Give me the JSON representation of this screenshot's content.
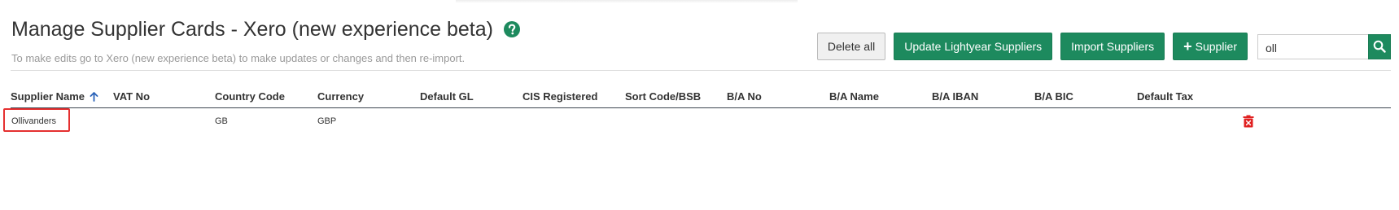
{
  "page": {
    "title": "Manage Supplier Cards - Xero (new experience beta)",
    "subtitle": "To make edits go to Xero (new experience beta) to make updates or changes and then re-import."
  },
  "toolbar": {
    "delete_all": "Delete all",
    "update_suppliers": "Update Lightyear Suppliers",
    "import_suppliers": "Import Suppliers",
    "add_supplier_plus": "+",
    "add_supplier": "Supplier",
    "search_value": "oll"
  },
  "table": {
    "columns": [
      "Supplier Name",
      "VAT No",
      "Country Code",
      "Currency",
      "Default GL",
      "CIS Registered",
      "Sort Code/BSB",
      "B/A No",
      "B/A Name",
      "B/A IBAN",
      "B/A BIC",
      "Default Tax"
    ],
    "sorted_column": "Supplier Name",
    "sort_direction": "ascending",
    "rows": [
      {
        "supplier_name": "Ollivanders",
        "vat_no": "",
        "country_code": "GB",
        "currency": "GBP",
        "default_gl": "",
        "cis_registered": "",
        "sort_code": "",
        "ba_no": "",
        "ba_name": "",
        "ba_iban": "",
        "ba_bic": "",
        "default_tax": ""
      }
    ]
  },
  "icons": {
    "help": "help-circle-icon",
    "sort": "arrow-up-icon",
    "search": "search-icon",
    "delete": "trash-icon"
  },
  "colors": {
    "brand_green": "#1d8a5e",
    "sort_arrow": "#2a63b8",
    "delete_red": "#e02020",
    "highlight_red": "#e53030"
  }
}
